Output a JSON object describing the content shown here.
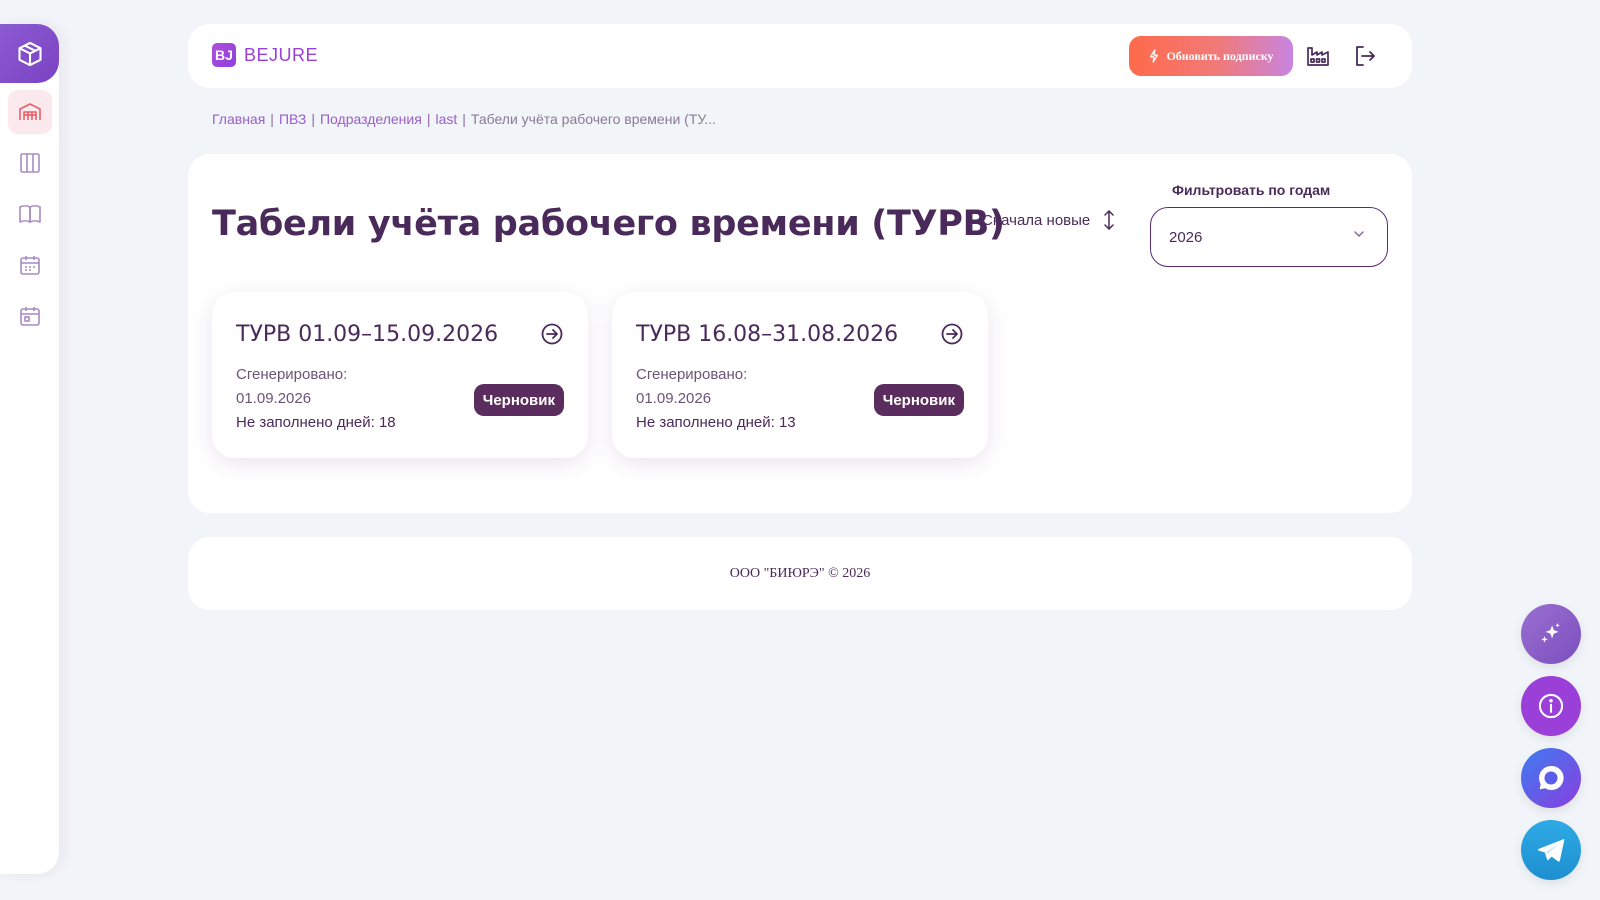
{
  "brand": {
    "logo_letters": "BJ",
    "name": "BEJURE"
  },
  "header": {
    "upgrade_label": "Обновить подписку"
  },
  "breadcrumb": {
    "items": [
      "Главная",
      "ПВЗ",
      "Подразделения",
      "last"
    ],
    "current": "Табели учёта рабочего времени (ТУ..."
  },
  "page": {
    "title": "Табели учёта рабочего времени (ТУРВ)",
    "sort_label": "Сначала новые",
    "filter_label": "Фильтровать по годам",
    "year_selected": "2026"
  },
  "cards": [
    {
      "title": "ТУРВ 01.09–15.09.2026",
      "generated_label": "Сгенерировано:",
      "generated_date": "01.09.2026",
      "unfilled": "Не заполнено дней: 18",
      "status": "Черновик"
    },
    {
      "title": "ТУРВ 16.08–31.08.2026",
      "generated_label": "Сгенерировано:",
      "generated_date": "01.09.2026",
      "unfilled": "Не заполнено дней: 13",
      "status": "Черновик"
    }
  ],
  "footer": {
    "text": "ООО \"БИЮРЭ\" © 2026"
  },
  "colors": {
    "primary": "#4a2a5a",
    "accent": "#9b3fd9",
    "badge": "#5a2d5e",
    "upgrade_start": "#ff6a4a",
    "upgrade_end": "#c884e0"
  },
  "icons": {
    "sidebar": [
      "cube-icon",
      "warehouse-icon",
      "columns-icon",
      "book-icon",
      "calendar-grid-icon",
      "calendar-icon"
    ],
    "header": [
      "factory-icon",
      "logout-icon"
    ],
    "fabs": [
      "sparkles-icon",
      "info-icon",
      "chat-icon",
      "telegram-icon"
    ]
  }
}
